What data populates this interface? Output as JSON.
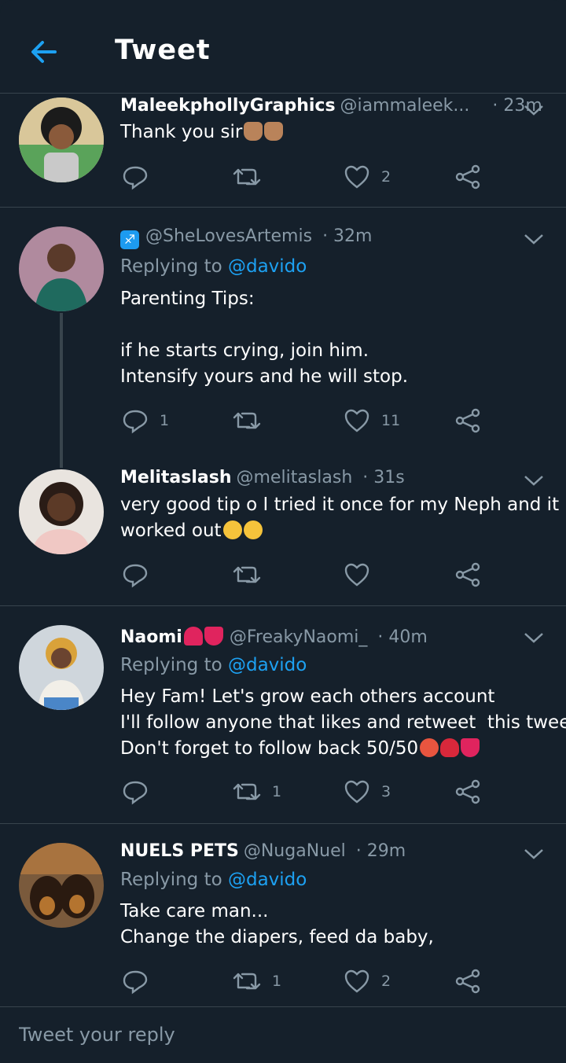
{
  "header": {
    "title": "Tweet"
  },
  "tweets": [
    {
      "name": "MaleekphollyGraphics",
      "handle": "@iammaleek...",
      "time": "· 23m",
      "text": "Thank you sir",
      "emojis": [
        "folded-hands",
        "folded-hands"
      ],
      "reply_count": "",
      "retweet_count": "",
      "like_count": "2"
    },
    {
      "name": "",
      "badge": "♐",
      "handle": "@SheLovesArtemis",
      "time": "· 32m",
      "replying_prefix": "Replying to",
      "replying_to": "@davido",
      "text": "Parenting Tips:\n\nif he starts crying, join him.\nIntensify yours and he will stop.",
      "reply_count": "1",
      "retweet_count": "",
      "like_count": "11"
    },
    {
      "name": "Melitaslash",
      "handle": "@melitaslash",
      "time": "· 31s",
      "text": "very good tip o I tried it once for my Neph and it\nworked out",
      "emojis": [
        "grinning-sweat",
        "grinning-sweat"
      ],
      "reply_count": "",
      "retweet_count": "",
      "like_count": ""
    },
    {
      "name": "Naomi",
      "name_emojis": [
        "two-hearts",
        "tongue"
      ],
      "handle": "@FreakyNaomi_",
      "time": "· 40m",
      "replying_prefix": "Replying to",
      "replying_to": "@davido",
      "text": "Hey Fam! Let's grow each others account\nI'll follow anyone that likes and retweet  this tweet\nDon't forget to follow back 50/50",
      "emojis": [
        "hot-face",
        "kiss-mark",
        "tongue"
      ],
      "reply_count": "",
      "retweet_count": "1",
      "like_count": "3"
    },
    {
      "name": "NUELS PETS",
      "handle": "@NugaNuel",
      "time": "· 29m",
      "replying_prefix": "Replying to",
      "replying_to": "@davido",
      "text": "Take care man...\nChange the diapers, feed da baby,",
      "reply_count": "",
      "retweet_count": "1",
      "like_count": "2"
    }
  ],
  "compose": {
    "placeholder": "Tweet your reply"
  },
  "colors": {
    "background": "#15202b",
    "accent": "#1da1f2",
    "muted": "#8899a6",
    "divider": "#38444d"
  },
  "icons": [
    "back-arrow-icon",
    "caret-down-icon",
    "reply-icon",
    "retweet-icon",
    "like-icon",
    "share-icon"
  ]
}
